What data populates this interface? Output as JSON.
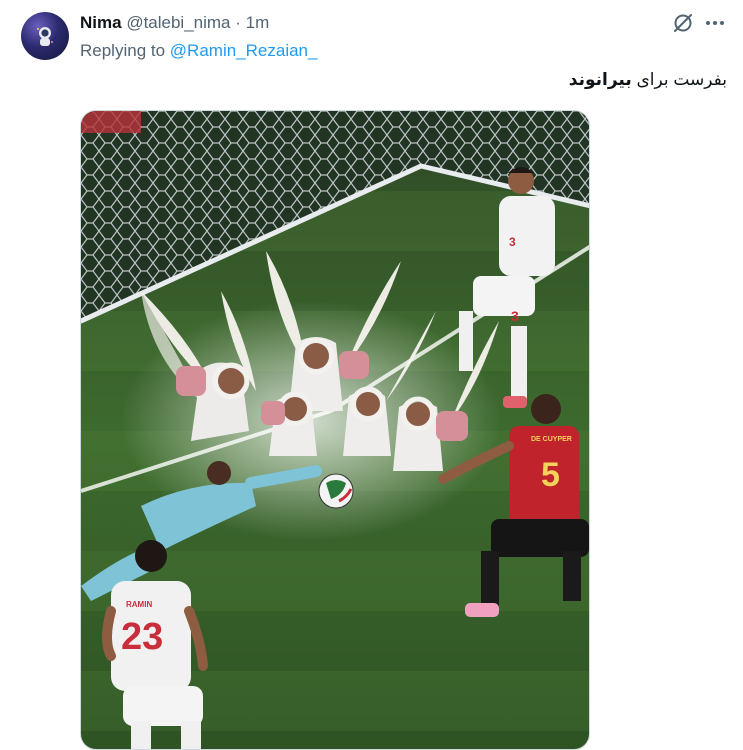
{
  "tweet": {
    "author_name": "Nima",
    "author_handle": "@talebi_nima",
    "separator": "·",
    "time": "1m",
    "reply_prefix": "Replying to",
    "reply_mention": "@Ramin_Rezaian_",
    "text_start": "بفرست برای",
    "text_bold": "بیرانوند"
  },
  "media": {
    "description_icons": [
      "grok-icon",
      "more-icon"
    ],
    "jersey_numbers": [
      "3",
      "5",
      "23"
    ],
    "jersey_names": [
      "DE CUYPER",
      "RAMIN"
    ]
  },
  "colors": {
    "accent": "#1d9bf0",
    "muted": "#536471",
    "text": "#0f1419"
  }
}
